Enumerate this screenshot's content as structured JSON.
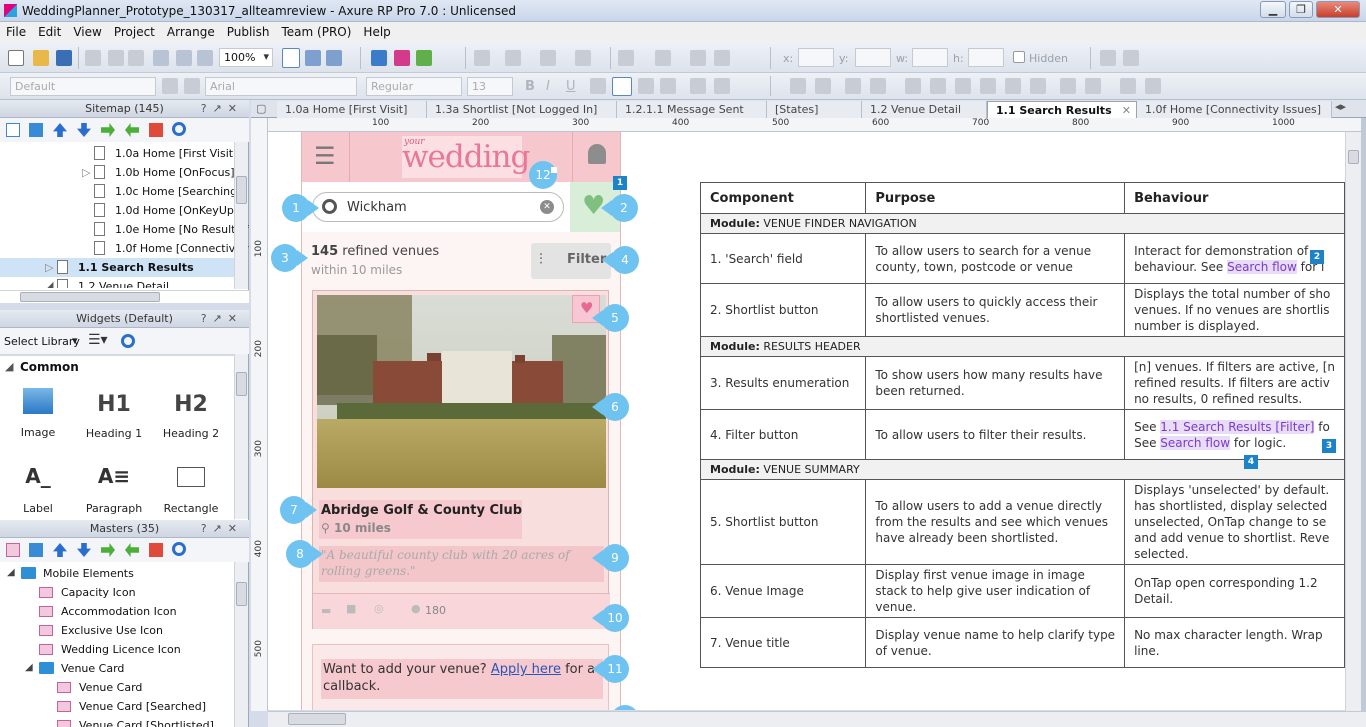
{
  "window": {
    "title": "WeddingPlanner_Prototype_130317_allteamreview - Axure RP Pro 7.0 : Unlicensed"
  },
  "menu": [
    "File",
    "Edit",
    "View",
    "Project",
    "Arrange",
    "Publish",
    "Team (PRO)",
    "Help"
  ],
  "toolbar": {
    "zoom": "100%",
    "style": "Default",
    "font": "Arial",
    "weight": "Regular",
    "size": "13",
    "x_label": "x:",
    "y_label": "y:",
    "w_label": "w:",
    "h_label": "h:",
    "hidden_label": "Hidden"
  },
  "sitemap": {
    "title": "Sitemap (145)",
    "items": [
      "1.0a Home [First Visit]",
      "1.0b Home [OnFocus]",
      "1.0c Home [Searching...",
      "1.0d Home [OnKeyUp]",
      "1.0e Home [No Results f",
      "1.0f Home [Connectivity",
      "1.1 Search Results",
      "1.2 Venue Detail"
    ]
  },
  "widgets": {
    "title": "Widgets (Default)",
    "select_library": "Select Library",
    "section": "Common",
    "items": [
      {
        "label": "Image"
      },
      {
        "label": "Heading 1",
        "glyph": "H1"
      },
      {
        "label": "Heading 2",
        "glyph": "H2"
      },
      {
        "label": "Label"
      },
      {
        "label": "Paragraph"
      },
      {
        "label": "Rectangle"
      }
    ]
  },
  "masters": {
    "title": "Masters (35)",
    "items": [
      "Mobile Elements",
      "Capacity Icon",
      "Accommodation Icon",
      "Exclusive Use Icon",
      "Wedding Licence Icon",
      "Venue Card",
      "Venue Card",
      "Venue Card [Searched]",
      "Venue Card [Shortlisted]"
    ]
  },
  "tabs": [
    "1.0a Home [First Visit]",
    "1.3a Shortlist [Not Logged In]",
    "1.2.1.1 Message Sent",
    "[States]",
    "1.2 Venue Detail",
    "1.1 Search Results",
    "1.0f Home [Connectivity Issues]"
  ],
  "ruler": {
    "h": [
      "100",
      "200",
      "300",
      "400",
      "500",
      "600",
      "700",
      "800",
      "900",
      "1000"
    ],
    "v": [
      "100",
      "200",
      "300",
      "400",
      "500"
    ]
  },
  "mobile": {
    "logo_small": "your",
    "logo": "wedding",
    "search_value": "Wickham",
    "results_count": "145",
    "results_text": "refined venues",
    "results_sub": "within 10 miles",
    "filter_label": "Filter",
    "venue_title": "Abridge Golf & County Club",
    "venue_distance": "10 miles",
    "venue_desc": "\"A beautiful county club with 20 acres of rolling greens.\"",
    "venue_capacity": "180",
    "cta_prefix": "Want to add your venue?",
    "cta_link": "Apply here",
    "cta_suffix": "for a callback.",
    "callouts": [
      "1",
      "2",
      "3",
      "4",
      "5",
      "6",
      "7",
      "8",
      "9",
      "10",
      "11",
      "12"
    ],
    "notes": [
      "1",
      "2",
      "3",
      "4"
    ]
  },
  "spec": {
    "headers": [
      "Component",
      "Purpose",
      "Behaviour"
    ],
    "modules": [
      {
        "label": "Module:",
        "name": "VENUE FINDER NAVIGATION",
        "rows": [
          {
            "component": "1. 'Search' field",
            "purpose": [
              "To allow users to search for a venue",
              "county, town, postcode or venue"
            ],
            "behaviour": [
              "Interact for demonstration of",
              "behaviour. See |Search flow| for l"
            ]
          },
          {
            "component": "2. Shortlist button",
            "purpose": [
              "To allow users to quickly access their",
              "shortlisted venues."
            ],
            "behaviour": [
              "Displays the total number of sho",
              "venues. If no venues are shortlis",
              "number is displayed."
            ]
          }
        ]
      },
      {
        "label": "Module:",
        "name": "RESULTS HEADER",
        "rows": [
          {
            "component": "3. Results enumeration",
            "purpose": [
              "To show users how many results have",
              "been returned."
            ],
            "behaviour": [
              "[n] venues. If filters are active, [n",
              "refined results. If filters are activ",
              "no results, 0 refined results."
            ]
          },
          {
            "component": "4. Filter button",
            "purpose": [
              "To allow users to filter their results."
            ],
            "behaviour": [
              "See |1.1 Search Results [Filter]| fo",
              "See |Search flow| for logic."
            ]
          }
        ]
      },
      {
        "label": "Module:",
        "name": "VENUE SUMMARY",
        "rows": [
          {
            "component": "5. Shortlist button",
            "purpose": [
              "To allow users to add a venue directly",
              "from the results and see which venues",
              "have already been shortlisted."
            ],
            "behaviour": [
              "Displays 'unselected' by default.",
              "has shortlisted, display selected",
              "unselected, OnTap change to se",
              "and add venue to shortlist. Reve",
              "selected."
            ]
          },
          {
            "component": "6. Venue Image",
            "purpose": [
              "Display first venue image in image",
              "stack to help give user indication of",
              "venue."
            ],
            "behaviour": [
              "OnTap open corresponding 1.2",
              "Detail."
            ]
          },
          {
            "component": "7. Venue title",
            "purpose": [
              "Display venue name to help clarify type",
              "of venue."
            ],
            "behaviour": [
              "No max character length. Wrap",
              "line."
            ]
          }
        ]
      }
    ]
  }
}
